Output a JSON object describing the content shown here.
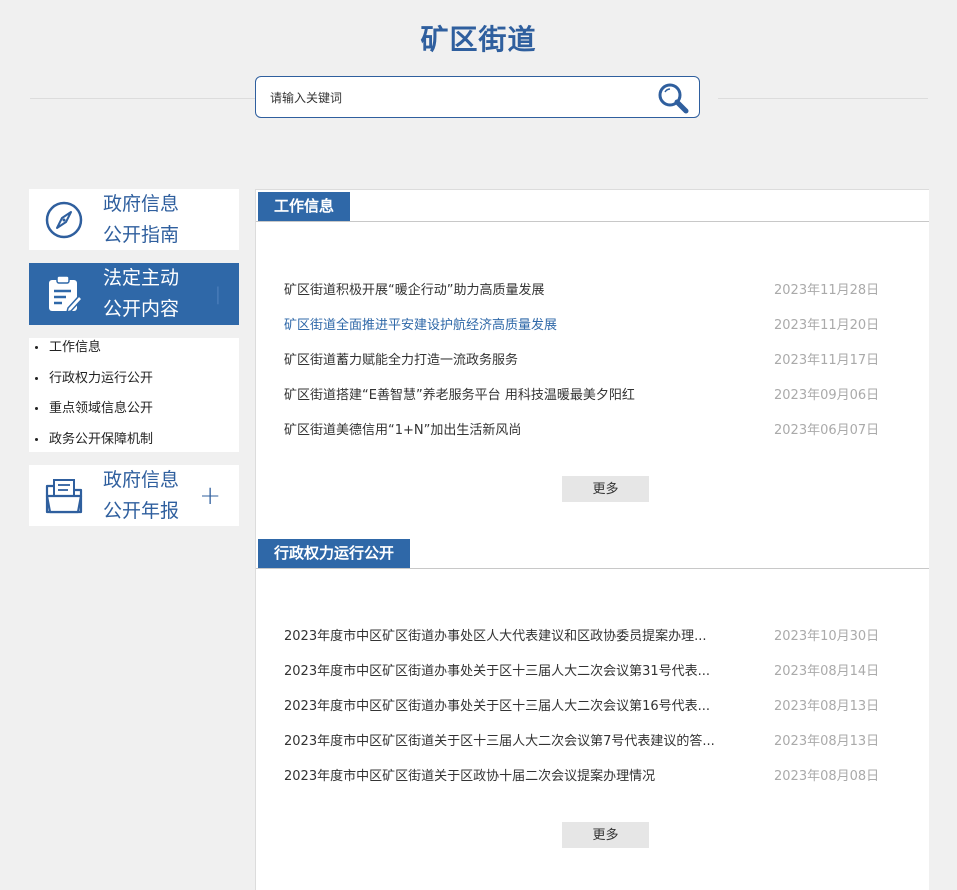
{
  "site": {
    "title": "矿区街道"
  },
  "search": {
    "placeholder": "请输入关键词",
    "value": ""
  },
  "sidebar": {
    "guide": {
      "label_line1": "政府信息",
      "label_line2": "公开指南"
    },
    "content": {
      "label_line1": "法定主动",
      "label_line2": "公开内容",
      "toggle": "|"
    },
    "sub_items": [
      {
        "label": "工作信息"
      },
      {
        "label": "行政权力运行公开"
      },
      {
        "label": "重点领域信息公开"
      },
      {
        "label": "政务公开保障机制"
      }
    ],
    "annual": {
      "label_line1": "政府信息",
      "label_line2": "公开年报",
      "toggle": "+"
    }
  },
  "sections": [
    {
      "title": "工作信息",
      "more_label": "更多",
      "items": [
        {
          "title": "矿区街道积极开展“暖企行动”助力高质量发展",
          "date": "2023年11月28日"
        },
        {
          "title": "矿区街道全面推进平安建设护航经济高质量发展",
          "date": "2023年11月20日"
        },
        {
          "title": "矿区街道蓄力赋能全力打造一流政务服务",
          "date": "2023年11月17日"
        },
        {
          "title": "矿区街道搭建“E善智慧”养老服务平台 用科技温暖最美夕阳红",
          "date": "2023年09月06日"
        },
        {
          "title": "矿区街道美德信用“1+N”加出生活新风尚",
          "date": "2023年06月07日"
        }
      ]
    },
    {
      "title": "行政权力运行公开",
      "more_label": "更多",
      "items": [
        {
          "title": "2023年度市中区矿区街道办事处区人大代表建议和区政协委员提案办理...",
          "date": "2023年10月30日"
        },
        {
          "title": "2023年度市中区矿区街道办事处关于区十三届人大二次会议第31号代表...",
          "date": "2023年08月14日"
        },
        {
          "title": "2023年度市中区矿区街道办事处关于区十三届人大二次会议第16号代表...",
          "date": "2023年08月13日"
        },
        {
          "title": "2023年度市中区矿区街道关于区十三届人大二次会议第7号代表建议的答...",
          "date": "2023年08月13日"
        },
        {
          "title": "2023年度市中区矿区街道关于区政协十届二次会议提案办理情况",
          "date": "2023年08月08日"
        }
      ]
    }
  ],
  "colors": {
    "accent": "#2f68a8",
    "title": "#2f5f9e",
    "date": "#aaaaaa",
    "background": "#f0f0f0"
  },
  "icons": {
    "search": "magnifier-icon",
    "guide": "compass-icon",
    "content": "clipboard-edit-icon",
    "annual": "folder-document-icon"
  }
}
